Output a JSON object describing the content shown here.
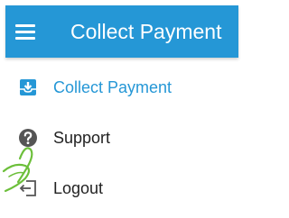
{
  "app_bar": {
    "title": "Collect Payment",
    "background_color": "#2597d6",
    "menu_icon": "hamburger-menu-icon"
  },
  "menu": {
    "items": [
      {
        "label": "Collect Payment",
        "icon": "download-box-icon",
        "active": true,
        "color": "#2597d6"
      },
      {
        "label": "Support",
        "icon": "help-circle-icon",
        "active": false,
        "color": "#222222"
      },
      {
        "label": "Logout",
        "icon": "logout-icon",
        "active": false,
        "color": "#222222"
      }
    ]
  },
  "overlay": {
    "icon": "touch-hand-icon",
    "color": "#6cbf3a"
  }
}
